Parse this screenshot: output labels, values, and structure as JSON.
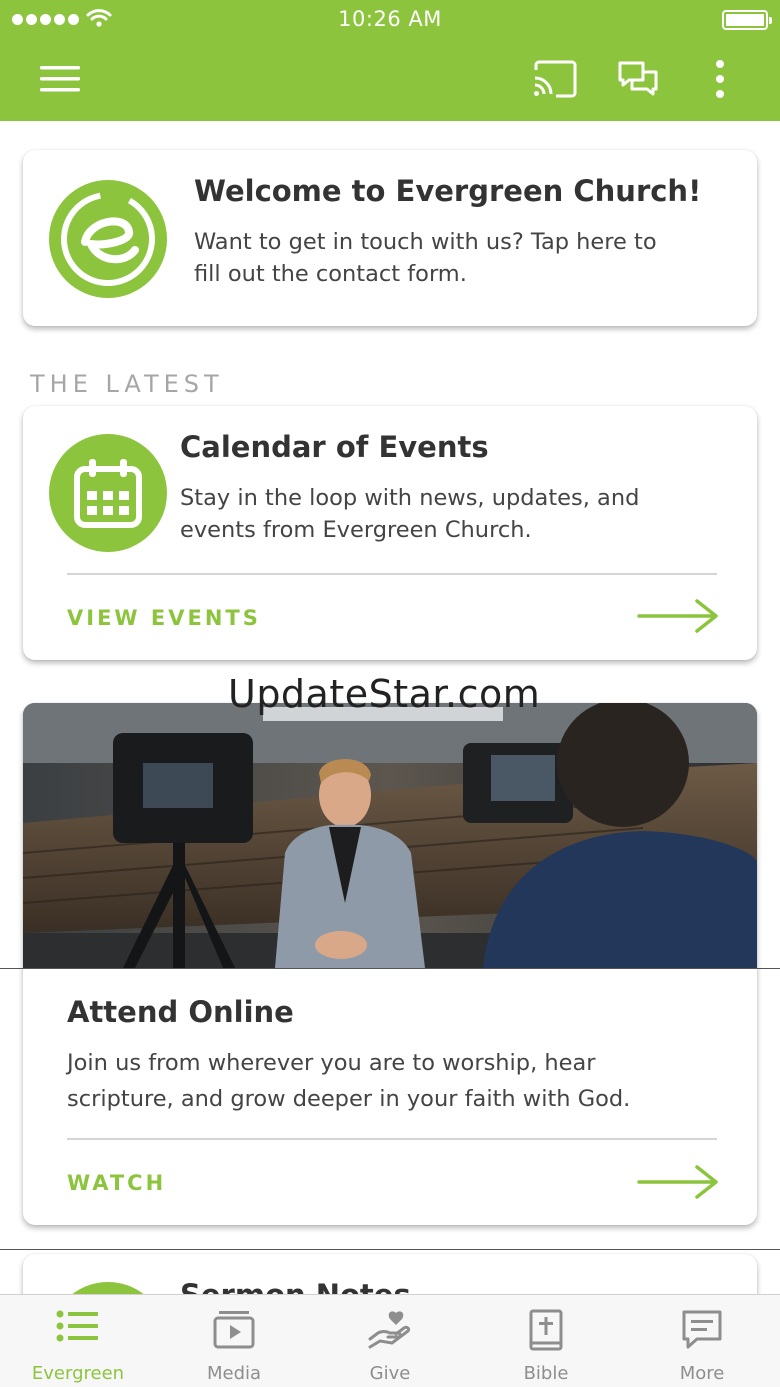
{
  "status_bar": {
    "time": "10:26 AM"
  },
  "top_bar": {
    "menu_icon": "hamburger-menu-icon",
    "cast_icon": "cast-icon",
    "chat_icon": "chat-bubbles-icon",
    "more_icon": "vertical-dots-icon",
    "color": "#8cc43e"
  },
  "welcome_card": {
    "title": "Welcome to Evergreen Church!",
    "text_line1": "Want to get in touch with us? Tap here to",
    "text_line2": "fill out the contact form.",
    "logo_letter": "e"
  },
  "section_title": "THE LATEST",
  "events_card": {
    "title": "Calendar of Events",
    "text_line1": "Stay in the loop with news, updates, and",
    "text_line2": "events from Evergreen Church.",
    "action": "VIEW EVENTS",
    "icon": "calendar-icon"
  },
  "watermark": "UpdateStar.com",
  "attend_card": {
    "title": "Attend Online",
    "text_line1": "Join us from wherever you are to worship, hear",
    "text_line2": "scripture, and grow deeper in your faith with God.",
    "action": "WATCH",
    "image": "pastor-speaking-to-cameras-photo"
  },
  "sermon_card": {
    "title": "Sermon Notes"
  },
  "tabs": [
    {
      "label": "Evergreen",
      "icon": "list-icon",
      "active": true
    },
    {
      "label": "Media",
      "icon": "media-play-icon",
      "active": false
    },
    {
      "label": "Give",
      "icon": "hand-heart-icon",
      "active": false
    },
    {
      "label": "Bible",
      "icon": "bible-icon",
      "active": false
    },
    {
      "label": "More",
      "icon": "message-square-icon",
      "active": false
    }
  ],
  "colors": {
    "accent": "#8cc43e",
    "text": "#333333",
    "section_label": "#a6a6a6"
  }
}
